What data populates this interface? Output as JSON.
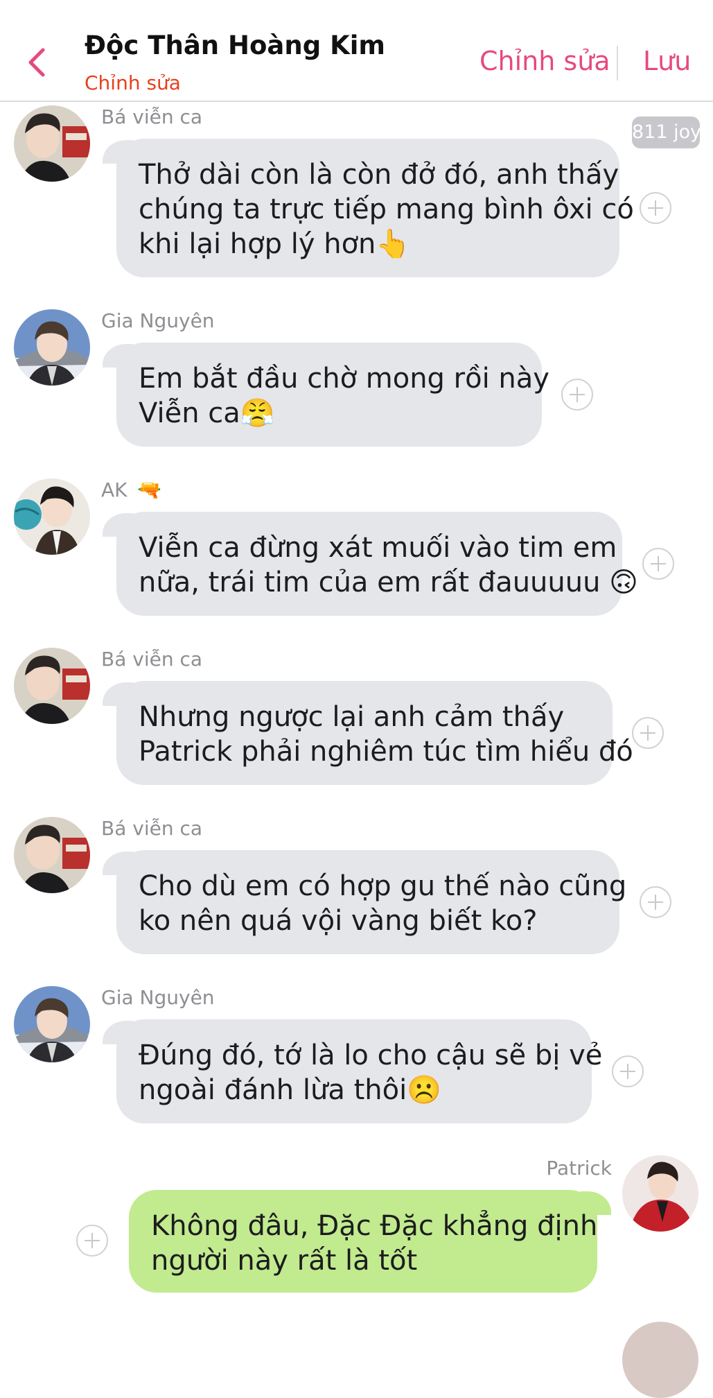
{
  "header": {
    "title": "Độc Thân Hoàng Kim",
    "subtitle": "Chỉnh sửa",
    "edit_label": "Chỉnh sửa",
    "save_label": "Lưu",
    "accent_color": "#e64980"
  },
  "joy_badge": "811 joy",
  "messages": [
    {
      "sender": "Bá viễn ca",
      "lines": [
        "Thở dài còn là còn đở đó, anh thấy",
        "chúng ta trực tiếp mang bình ôxi có",
        "khi lại hợp lý hơn👆"
      ]
    },
    {
      "sender": "Gia Nguyên",
      "lines": [
        "Em bắt đầu chờ mong rồi này",
        "Viễn ca😤"
      ]
    },
    {
      "sender": "AK",
      "sender_emoji": "🔫",
      "lines": [
        "Viễn ca đừng xát muối vào tim em",
        "nữa, trái tim của em rất đauuuuu 🙃"
      ]
    },
    {
      "sender": "Bá viễn ca",
      "lines": [
        "Nhưng ngược lại anh cảm thấy",
        "Patrick phải nghiêm túc tìm hiểu đó"
      ]
    },
    {
      "sender": "Bá viễn ca",
      "lines": [
        "Cho dù em có hợp gu thế nào cũng",
        "ko nên quá vội vàng biết ko?"
      ]
    },
    {
      "sender": "Gia Nguyên",
      "lines": [
        "Đúng đó, tớ là lo cho cậu sẽ bị vẻ",
        "ngoài đánh lừa thôi☹️"
      ]
    },
    {
      "sender": "Patrick",
      "lines": [
        "Không đâu, Đặc Đặc khẳng định",
        "người này rất là tốt"
      ]
    }
  ],
  "colors": {
    "incoming_bubble": "#e4e6e9",
    "outgoing_bubble": "#c2ea8f",
    "sender_name": "#8e8e93"
  }
}
